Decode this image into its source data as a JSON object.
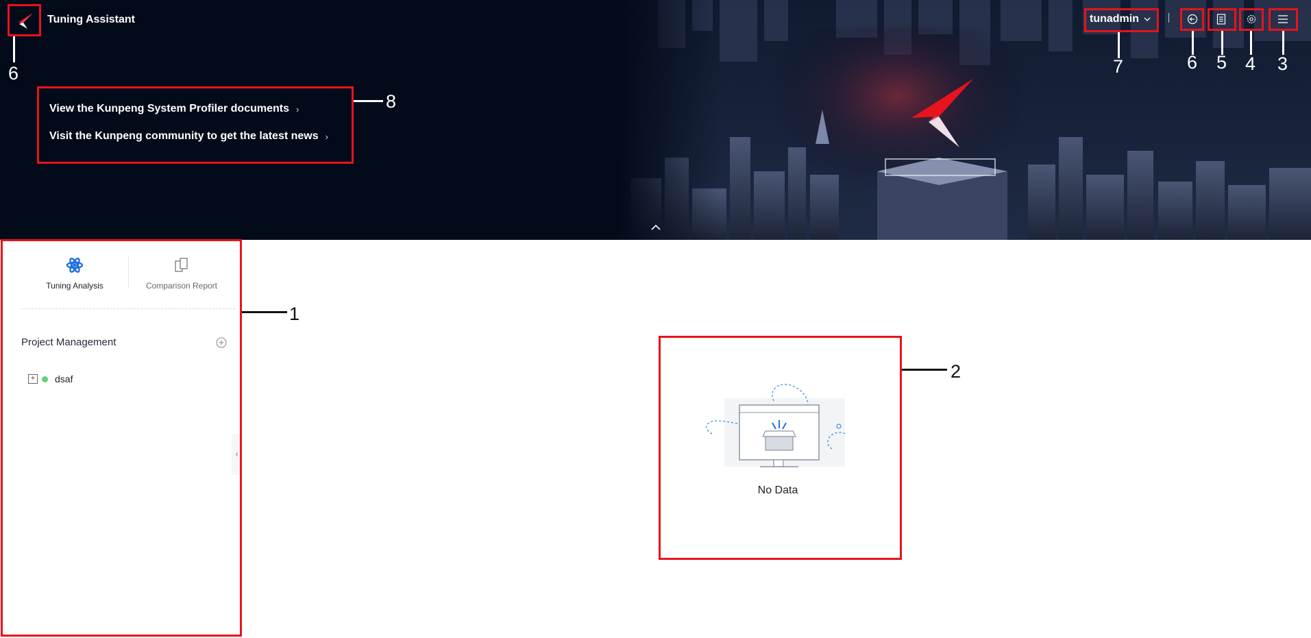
{
  "header": {
    "app_title": "Tuning Assistant",
    "username": "tunadmin",
    "icons": [
      "back-icon",
      "document-icon",
      "gear-icon",
      "menu-icon"
    ]
  },
  "banner": {
    "links": [
      "View the Kunpeng System Profiler documents",
      "Visit the Kunpeng community to get the latest news"
    ]
  },
  "sidebar": {
    "tabs": [
      {
        "label": "Tuning Analysis",
        "active": true
      },
      {
        "label": "Comparison Report",
        "active": false
      }
    ],
    "section_title": "Project Management",
    "projects": [
      {
        "name": "dsaf",
        "status_color": "#5ed27b"
      }
    ]
  },
  "main": {
    "empty_text": "No Data"
  },
  "callouts": [
    "1",
    "2",
    "3",
    "4",
    "5",
    "6",
    "6",
    "7",
    "8"
  ],
  "colors": {
    "highlight": "#e8131c",
    "banner_bg": "#030b1a",
    "accent": "#1f6fe0"
  }
}
